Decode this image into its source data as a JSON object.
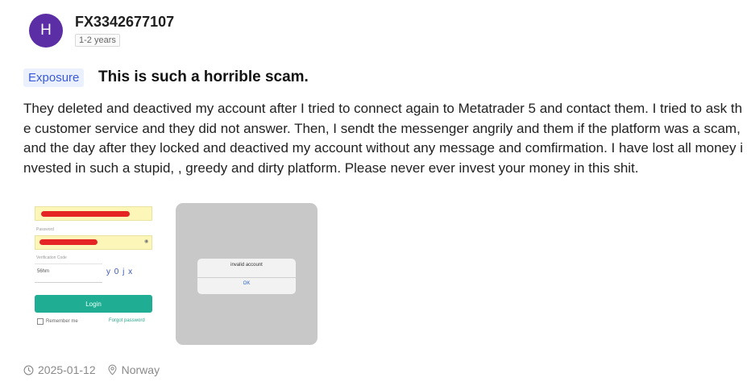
{
  "user": {
    "avatar_letter": "H",
    "name": "FX3342677107",
    "years": "1-2 years"
  },
  "post": {
    "tag": "Exposure",
    "title": "This is such a horrible scam.",
    "body": "They deleted and deactived my account after I tried to connect again to Metatrader 5 and contact them. I tried to ask the customer service and they did not answer. Then, I sendt the messenger angrily and them if the platform was a scam, and the day after they locked and deactived my account without any message and comfirmation. I have lost all money invested in such a stupid, , greedy and dirty platform. Please never ever invest your money in this shit."
  },
  "images": {
    "login": {
      "password_label": "Password",
      "captcha_label": "Verification Code",
      "captcha_value": "56hm",
      "captcha_code": "y 0 j x",
      "login_button": "Login",
      "remember_label": "Remember me",
      "forgot_label": "Forgot password"
    },
    "dialog": {
      "message": "invalid account",
      "ok_button": "OK"
    }
  },
  "footer": {
    "date": "2025-01-12",
    "location": "Norway",
    "clock_icon": "clock-icon",
    "location_icon": "location-pin-icon"
  },
  "colors": {
    "avatar": "#5b2ea6",
    "tag_text": "#3a5bd8",
    "tag_bg": "#eaf0fd",
    "login_button": "#1fae93",
    "redaction": "#e52424"
  }
}
